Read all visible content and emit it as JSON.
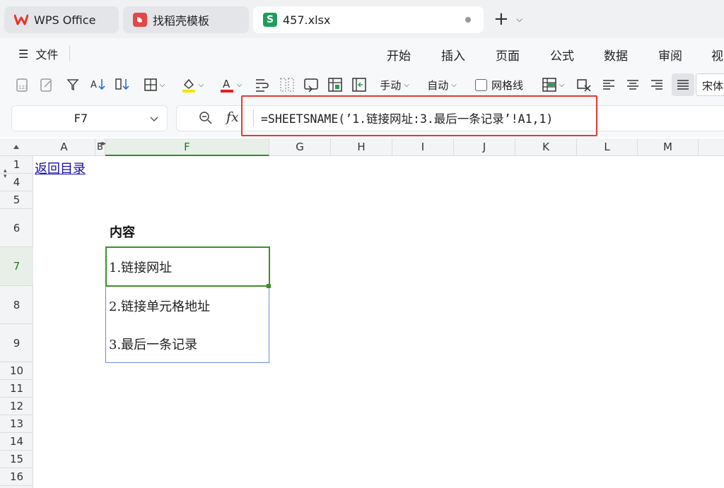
{
  "titlebar": {
    "tabs": [
      {
        "label": "WPS Office",
        "icon": "wps-logo-icon"
      },
      {
        "label": "找稻壳模板",
        "icon": "daoke-logo-icon"
      },
      {
        "label": "457.xlsx",
        "icon": "spreadsheet-s-icon"
      }
    ],
    "new_tab": "+"
  },
  "menubar": {
    "file_label": "文件",
    "items": [
      "开始",
      "插入",
      "页面",
      "公式",
      "数据",
      "审阅",
      "视"
    ]
  },
  "toolbar": {
    "calc_manual": "手动",
    "calc_auto": "自动",
    "gridlines_label": "网格线",
    "font_name": "宋体",
    "colors": {
      "highlight": "#f2e600",
      "font_color": "#e02020"
    }
  },
  "formula_bar": {
    "name_box": "F7",
    "fx_label": "fx",
    "formula": "=SHEETSNAME(’1.链接网址:3.最后一条记录’!A1,1)"
  },
  "grid": {
    "columns": [
      "A",
      "B",
      "F",
      "G",
      "H",
      "I",
      "J",
      "K",
      "L",
      "M"
    ],
    "rows": [
      "1",
      "4",
      "5",
      "6",
      "7",
      "8",
      "9",
      "10",
      "11",
      "12",
      "13",
      "14",
      "15",
      "16"
    ],
    "active_column": "F",
    "active_row": "7",
    "cells": {
      "A1": "返回目录",
      "F6": "内容",
      "F7": "1.链接网址",
      "F8": "2.链接单元格地址",
      "F9": "3.最后一条记录"
    }
  }
}
